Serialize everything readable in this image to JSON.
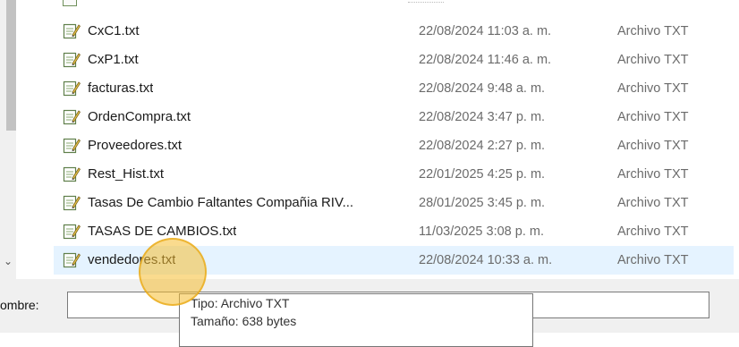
{
  "files": [
    {
      "name": "CxC1.txt",
      "date": "22/08/2024 11:03 a. m.",
      "type": "Archivo TXT",
      "selected": false
    },
    {
      "name": "CxP1.txt",
      "date": "22/08/2024 11:46 a. m.",
      "type": "Archivo TXT",
      "selected": false
    },
    {
      "name": "facturas.txt",
      "date": "22/08/2024 9:48 a. m.",
      "type": "Archivo TXT",
      "selected": false
    },
    {
      "name": "OrdenCompra.txt",
      "date": "22/08/2024 3:47 p. m.",
      "type": "Archivo TXT",
      "selected": false
    },
    {
      "name": "Proveedores.txt",
      "date": "22/08/2024 2:27 p. m.",
      "type": "Archivo TXT",
      "selected": false
    },
    {
      "name": "Rest_Hist.txt",
      "date": "22/01/2025 4:25 p. m.",
      "type": "Archivo TXT",
      "selected": false
    },
    {
      "name": "Tasas De Cambio Faltantes Compañia RIV...",
      "date": "28/01/2025 3:45 p. m.",
      "type": "Archivo TXT",
      "selected": false
    },
    {
      "name": "TASAS DE CAMBIOS.txt",
      "date": "11/03/2025 3:08 p. m.",
      "type": "Archivo TXT",
      "selected": false
    },
    {
      "name": "vendedores.txt",
      "date": "22/08/2024 10:33 a. m.",
      "type": "Archivo TXT",
      "selected": true
    }
  ],
  "file_name_field": {
    "label": "ombre:",
    "value": ""
  },
  "tooltip": {
    "type_line": "Tipo: Archivo TXT",
    "size_line": "Tamaño: 638 bytes"
  },
  "scrollbar": {
    "down_arrow": "⌄"
  },
  "colors": {
    "selection": "#e5f3ff",
    "cursor_highlight": "#f6be32",
    "meta_text": "#6b6b6b"
  },
  "icons": {
    "file": "text-file-icon"
  }
}
